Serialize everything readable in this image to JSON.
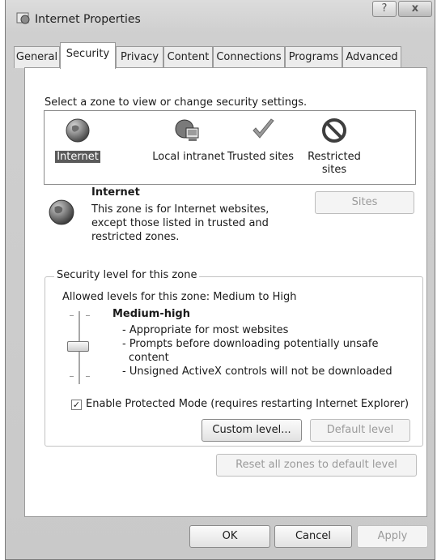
{
  "window": {
    "title": "Internet Properties",
    "help_glyph": "?",
    "close_glyph": "x"
  },
  "tabs": [
    "General",
    "Security",
    "Privacy",
    "Content",
    "Connections",
    "Programs",
    "Advanced"
  ],
  "active_tab": "Security",
  "security": {
    "zone_prompt": "Select a zone to view or change security settings.",
    "zones": [
      {
        "label": "Internet",
        "icon": "globe-icon",
        "selected": true
      },
      {
        "label": "Local intranet",
        "icon": "intranet-icon",
        "selected": false
      },
      {
        "label": "Trusted sites",
        "icon": "checkmark-icon",
        "selected": false
      },
      {
        "label": "Restricted sites",
        "label_line1": "Restricted",
        "label_line2": "sites",
        "icon": "restricted-icon",
        "selected": false
      }
    ],
    "zone_info": {
      "title": "Internet",
      "description": "This zone is for Internet websites, except those listed in trusted and restricted zones."
    },
    "sites_button": "Sites",
    "level_group_label": "Security level for this zone",
    "allowed_levels": "Allowed levels for this zone: Medium to High",
    "level_name": "Medium-high",
    "level_bullets": [
      "- Appropriate for most websites",
      "- Prompts before downloading potentially unsafe content",
      "- Unsigned ActiveX controls will not be downloaded"
    ],
    "protected_mode": {
      "label": "Enable Protected Mode (requires restarting Internet Explorer)",
      "checked": true
    },
    "custom_level_button": "Custom level...",
    "default_level_button": "Default level",
    "reset_all_button": "Reset all zones to default level"
  },
  "dialog_buttons": {
    "ok": "OK",
    "cancel": "Cancel",
    "apply": "Apply"
  }
}
